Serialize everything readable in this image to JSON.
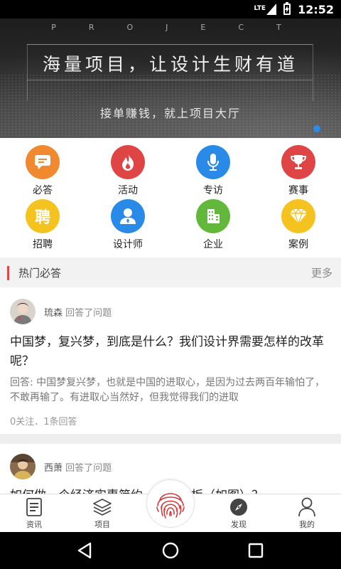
{
  "status_bar": {
    "network": "LTE",
    "time": "12:52"
  },
  "banner": {
    "overline": "PROJECT",
    "headline": "海量项目，让设计生财有道",
    "subline": "接单赚钱，就上项目大厅"
  },
  "categories": [
    {
      "label": "必答",
      "icon": "chat-icon",
      "color": "#f0892f"
    },
    {
      "label": "活动",
      "icon": "flame-icon",
      "color": "#e04545"
    },
    {
      "label": "专访",
      "icon": "microphone-icon",
      "color": "#2a8ae8"
    },
    {
      "label": "赛事",
      "icon": "trophy-icon",
      "color": "#e04545"
    },
    {
      "label": "招聘",
      "icon": "hire-icon",
      "glyph": "聘",
      "color": "#f5c31f"
    },
    {
      "label": "设计师",
      "icon": "user-icon",
      "color": "#2a8ae8"
    },
    {
      "label": "企业",
      "icon": "building-icon",
      "color": "#62b83a"
    },
    {
      "label": "案例",
      "icon": "diamond-icon",
      "color": "#f5c31f"
    }
  ],
  "section": {
    "title": "热门必答",
    "more": "更多"
  },
  "feed": [
    {
      "author": "琉森",
      "action": "回答了问题",
      "question": "中国梦，复兴梦，到底是什么？我们设计界需要怎样的改革呢？",
      "answer": "回答: 中国梦复兴梦，也就是中国的进取心，是因为过去两百年输怕了，不敢再输了。有进取心当然好，但我觉得我们的进取",
      "stats": "0关注．1条回答"
    },
    {
      "author": "西萧",
      "action": "回答了问题",
      "question": "如何做一个经济实惠简约、造木机板（如图）？"
    }
  ],
  "tabs": [
    {
      "label": "资讯",
      "icon": "news-icon"
    },
    {
      "label": "项目",
      "icon": "layers-icon"
    },
    {
      "label": "",
      "icon": "fingerprint-icon"
    },
    {
      "label": "发现",
      "icon": "compass-icon"
    },
    {
      "label": "我的",
      "icon": "profile-icon"
    }
  ],
  "colors": {
    "accent_red": "#e04848",
    "accent_blue": "#2b8be6"
  }
}
